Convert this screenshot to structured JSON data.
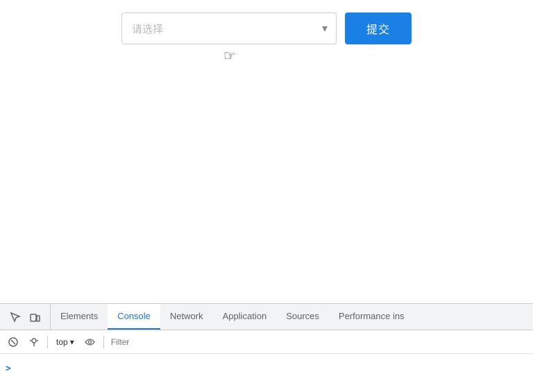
{
  "main": {
    "select_placeholder": "请选择",
    "submit_label": "提交",
    "select_arrow": "▾"
  },
  "devtools": {
    "tabs": [
      {
        "id": "elements",
        "label": "Elements",
        "active": false
      },
      {
        "id": "console",
        "label": "Console",
        "active": true
      },
      {
        "id": "network",
        "label": "Network",
        "active": false
      },
      {
        "id": "application",
        "label": "Application",
        "active": false
      },
      {
        "id": "sources",
        "label": "Sources",
        "active": false
      },
      {
        "id": "performance",
        "label": "Performance ins",
        "active": false
      }
    ],
    "toolbar": {
      "top_label": "top",
      "filter_placeholder": "Filter"
    }
  },
  "console": {
    "prompt": ">"
  },
  "icons": {
    "inspect": "⬚",
    "device": "▭",
    "play": "▶",
    "ban": "⊘",
    "arrow_down": "▾",
    "eye": "◉",
    "chevron_right": "❯"
  },
  "colors": {
    "active_tab_blue": "#1a73e8",
    "submit_blue": "#1a80e6",
    "border_gray": "#d0d0d0",
    "text_placeholder": "#bbb",
    "devtools_bg": "#f1f3f4"
  }
}
